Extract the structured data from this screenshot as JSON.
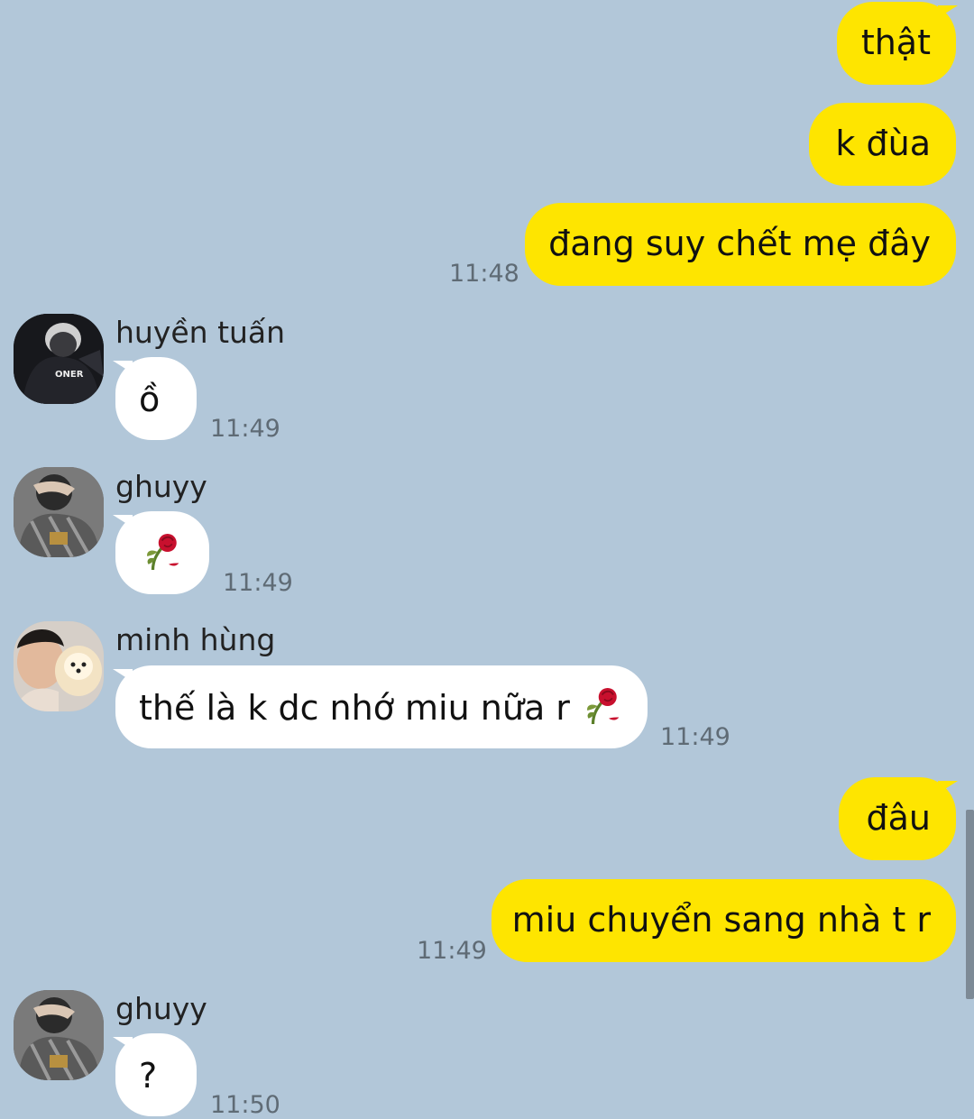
{
  "messages": {
    "m1": {
      "text": "thật"
    },
    "m2": {
      "text": "k đùa"
    },
    "m3": {
      "text": "đang suy chết mẹ đây",
      "time": "11:48"
    },
    "m4": {
      "sender": "huyền tuấn",
      "text": "ồ",
      "time": "11:49",
      "avatar_label": "ONER"
    },
    "m5": {
      "sender": "ghuyy",
      "time": "11:49"
    },
    "m6": {
      "sender": "minh hùng",
      "text": "thế là k dc nhớ miu nữa r",
      "time": "11:49"
    },
    "m7": {
      "text": "đâu"
    },
    "m8": {
      "text": "miu chuyển sang nhà t r",
      "time": "11:49"
    },
    "m9": {
      "sender": "ghuyy",
      "text": "?",
      "time": "11:50"
    }
  },
  "colors": {
    "background": "#b2c7d9",
    "outgoing_bubble": "#fee500",
    "incoming_bubble": "#ffffff"
  },
  "icons": {
    "wilted_rose": "wilted-rose-icon"
  }
}
